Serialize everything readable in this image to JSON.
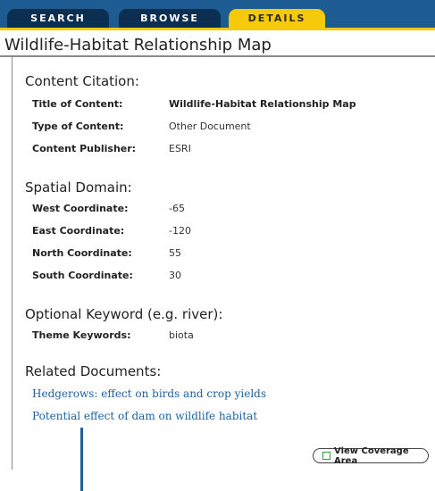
{
  "tabs": {
    "search": "SEARCH",
    "browse": "BROWSE",
    "details": "DETAILS"
  },
  "page_title": "Wildlife-Habitat Relationship Map",
  "content_citation": {
    "heading": "Content Citation:",
    "rows": [
      {
        "label": "Title of Content:",
        "value": "Wildlife-Habitat Relationship Map"
      },
      {
        "label": "Type of Content:",
        "value": "Other Document"
      },
      {
        "label": "Content Publisher:",
        "value": "ESRI"
      }
    ]
  },
  "spatial_domain": {
    "heading": "Spatial Domain:",
    "rows": [
      {
        "label": "West Coordinate:",
        "value": "-65"
      },
      {
        "label": "East Coordinate:",
        "value": "-120"
      },
      {
        "label": "North Coordinate:",
        "value": "55"
      },
      {
        "label": "South Coordinate:",
        "value": "30"
      }
    ]
  },
  "keywords": {
    "heading": "Optional Keyword (e.g. river):",
    "rows": [
      {
        "label": "Theme Keywords:",
        "value": "biota"
      }
    ]
  },
  "related_documents": {
    "heading": "Related Documents:",
    "links": [
      "Hedgerows: effect on birds and crop yields",
      "Potential effect of dam on wildlife habitat"
    ]
  },
  "coverage_button": "View Coverage Area",
  "colors": {
    "tab_bar": "#1d5b93",
    "tab": "#0b2e51",
    "active_tab": "#f7c90b",
    "link": "#1e5f9e"
  }
}
